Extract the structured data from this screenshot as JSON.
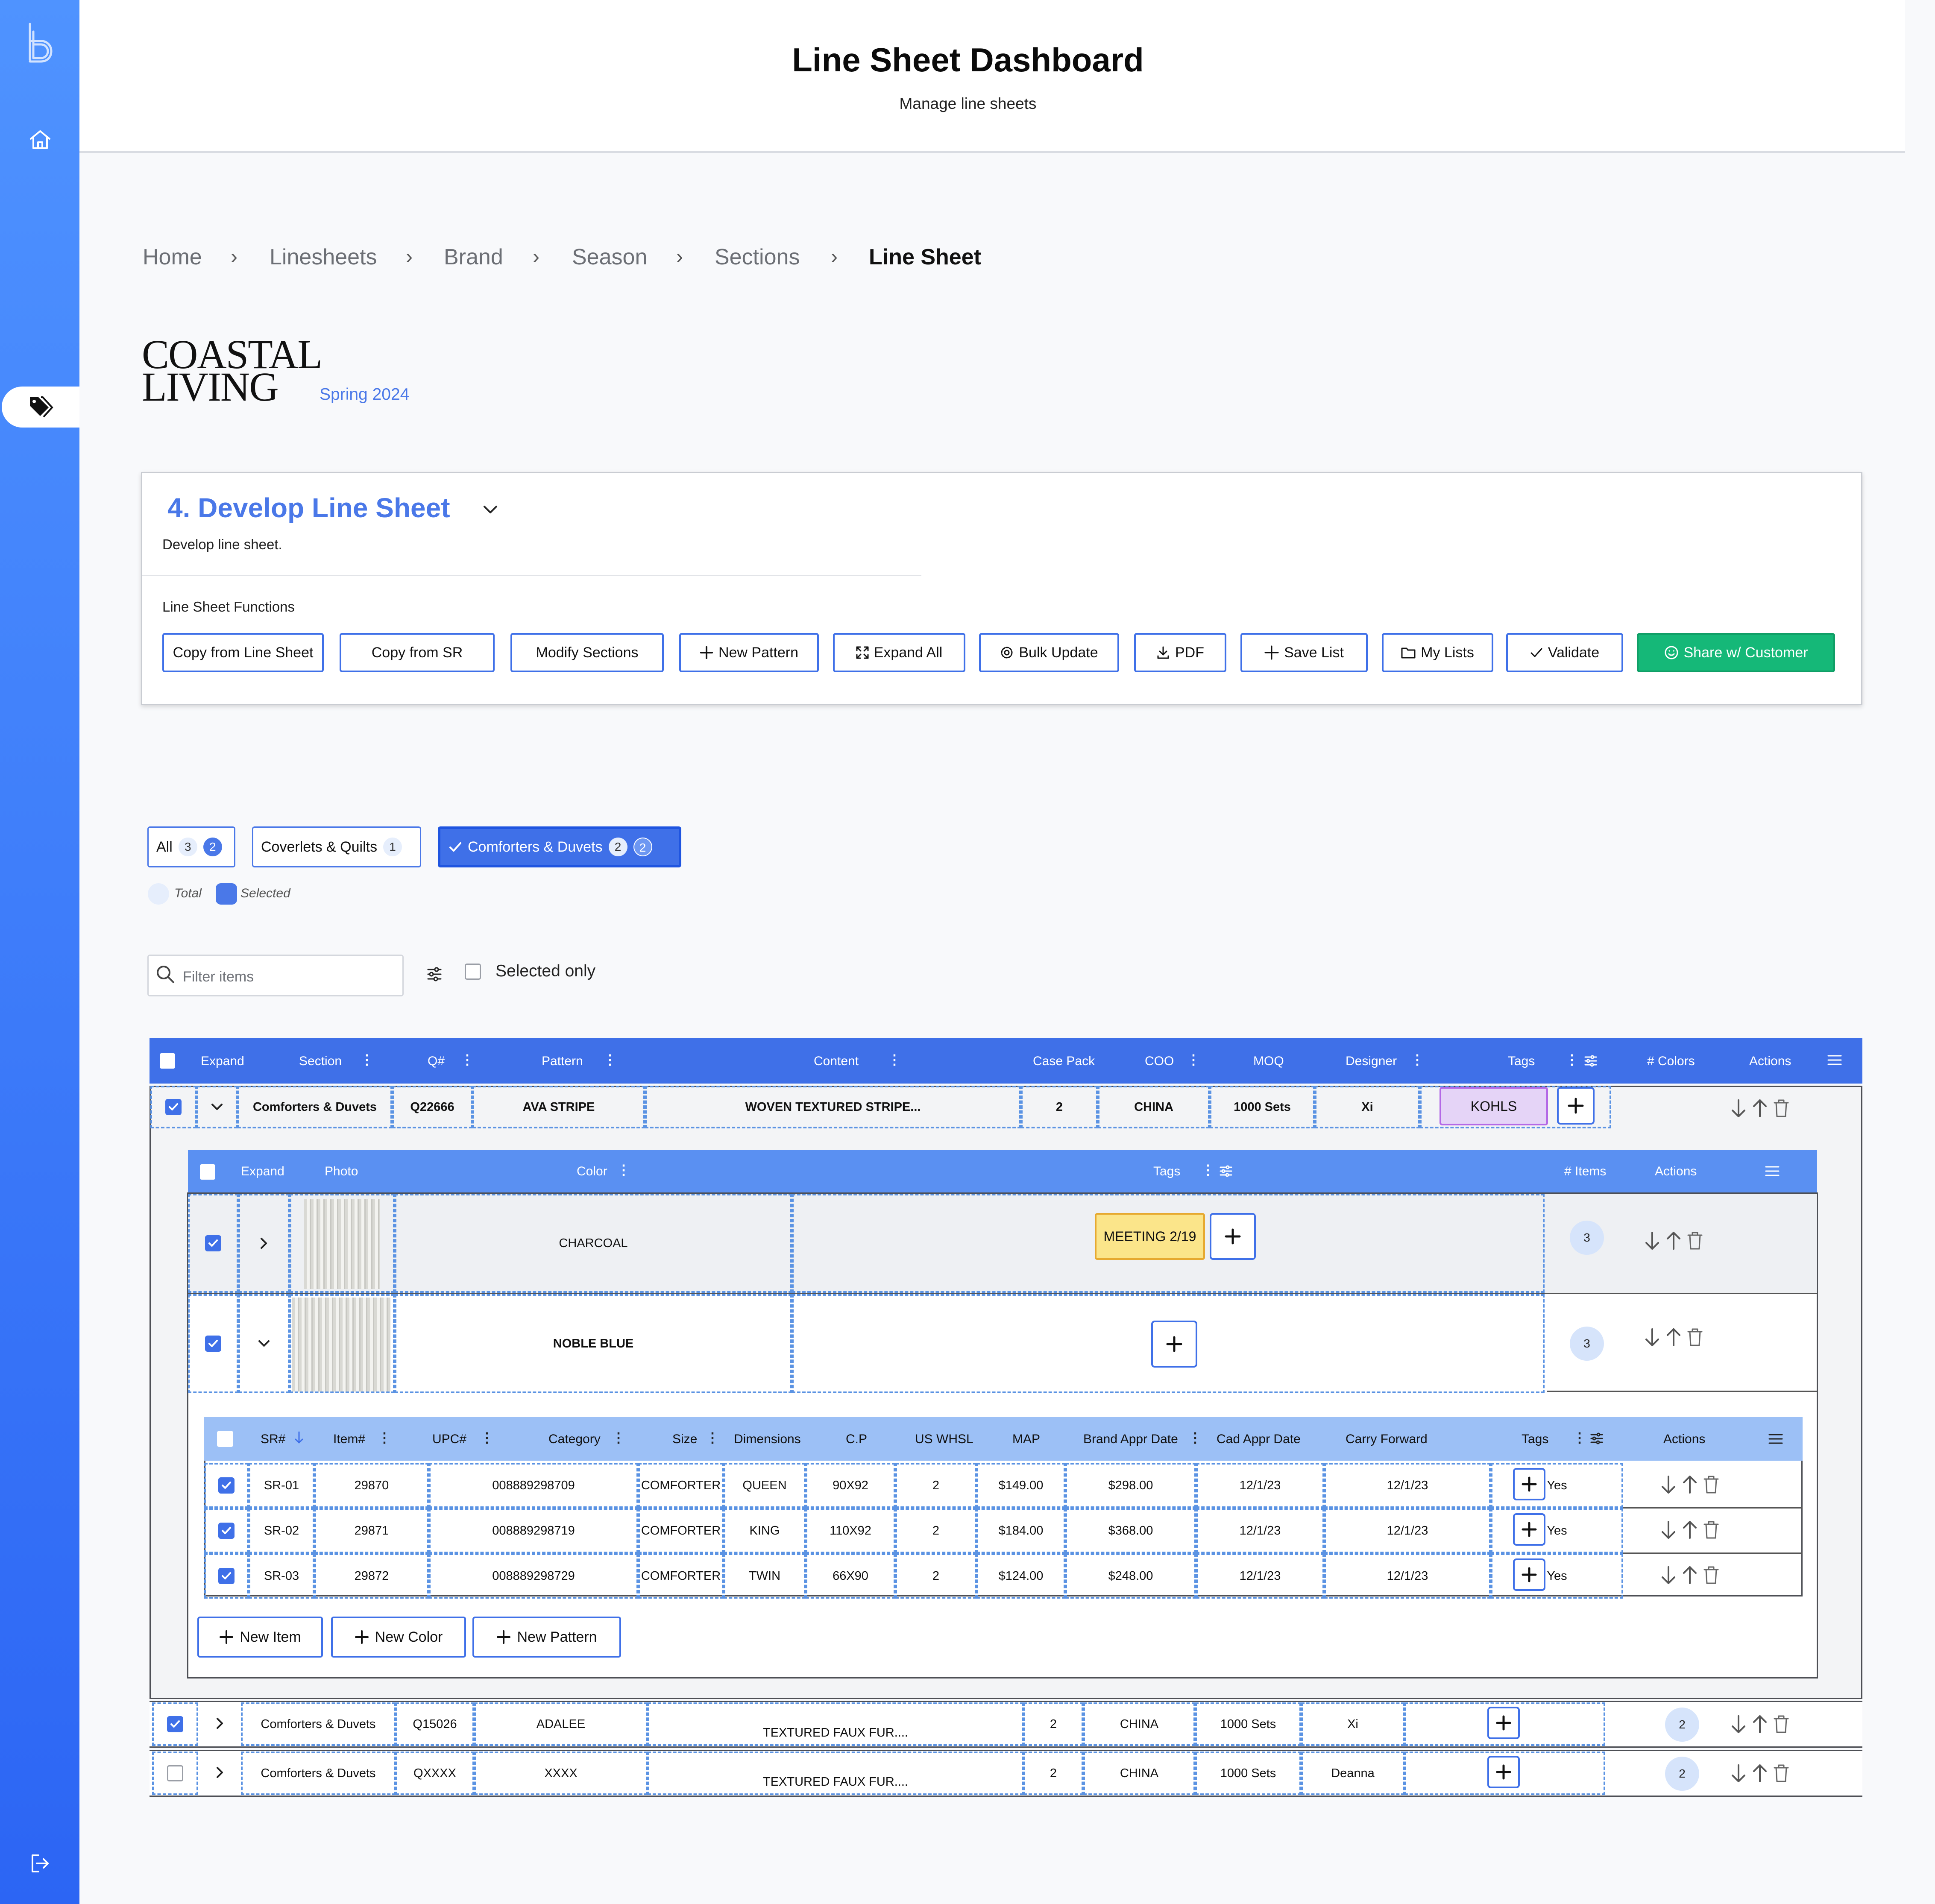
{
  "header": {
    "title": "Line Sheet Dashboard",
    "subtitle": "Manage line sheets"
  },
  "breadcrumb": [
    "Home",
    "Linesheets",
    "Brand",
    "Season",
    "Sections",
    "Line Sheet"
  ],
  "brand": {
    "logo_text": "COASTAL LIVING",
    "season": "Spring 2024"
  },
  "panel": {
    "title": "4. Develop Line Sheet",
    "description": "Develop line sheet.",
    "functions_label": "Line Sheet Functions",
    "buttons": [
      "Copy from Line Sheet",
      "Copy from SR",
      "Modify Sections",
      "New Pattern",
      "Expand All",
      "Bulk Update",
      "PDF",
      "Save List",
      "My Lists",
      "Validate",
      "Share w/ Customer"
    ]
  },
  "filters": {
    "chips": [
      {
        "label": "All",
        "total": "3",
        "selected": "2"
      },
      {
        "label": "Coverlets & Quilts",
        "total": "1"
      },
      {
        "label": "Comforters & Duvets",
        "total": "2",
        "selected": "2"
      }
    ],
    "legend_total": "Total",
    "legend_selected": "Selected"
  },
  "search": {
    "placeholder": "Filter items",
    "selected_only": "Selected only"
  },
  "table": {
    "headers": [
      "Expand",
      "Section",
      "Q#",
      "Pattern",
      "Content",
      "Case Pack",
      "COO",
      "MOQ",
      "Designer",
      "Tags",
      "# Colors",
      "Actions"
    ],
    "rows": [
      {
        "section": "Comforters & Duvets",
        "q": "Q22666",
        "pattern": "AVA STRIPE",
        "content": "WOVEN TEXTURED STRIPE...",
        "case_pack": "2",
        "coo": "CHINA",
        "moq": "1000 Sets",
        "designer": "Xi",
        "tag": "KOHLS"
      },
      {
        "section": "Comforters & Duvets",
        "q": "Q15026",
        "pattern": "ADALEE",
        "content": "TEXTURED FAUX FUR....",
        "case_pack": "2",
        "coo": "CHINA",
        "moq": "1000 Sets",
        "designer": "Xi",
        "colors": "2"
      },
      {
        "section": "Comforters & Duvets",
        "q": "QXXXX",
        "pattern": "XXXX",
        "content": "TEXTURED FAUX FUR....",
        "case_pack": "2",
        "coo": "CHINA",
        "moq": "1000 Sets",
        "designer": "Deanna",
        "colors": "2"
      }
    ]
  },
  "colors_table": {
    "headers": [
      "Expand",
      "Photo",
      "Color",
      "Tags",
      "# Items",
      "Actions"
    ],
    "rows": [
      {
        "color": "CHARCOAL",
        "tag": "MEETING 2/19",
        "items": "3"
      },
      {
        "color": "NOBLE BLUE",
        "items": "3"
      }
    ]
  },
  "items_table": {
    "headers": [
      "SR#",
      "Item#",
      "UPC#",
      "Category",
      "Size",
      "Dimensions",
      "C.P",
      "US WHSL",
      "MAP",
      "Brand Appr Date",
      "Cad Appr Date",
      "Carry Forward",
      "Tags",
      "Actions"
    ],
    "rows": [
      [
        "SR-01",
        "29870",
        "008889298709",
        "COMFORTER",
        "QUEEN",
        "90X92",
        "2",
        "$149.00",
        "$298.00",
        "12/1/23",
        "12/1/23",
        "Yes"
      ],
      [
        "SR-02",
        "29871",
        "008889298719",
        "COMFORTER",
        "KING",
        "110X92",
        "2",
        "$184.00",
        "$368.00",
        "12/1/23",
        "12/1/23",
        "Yes"
      ],
      [
        "SR-03",
        "29872",
        "008889298729",
        "COMFORTER",
        "TWIN",
        "66X90",
        "2",
        "$124.00",
        "$248.00",
        "12/1/23",
        "12/1/23",
        "Yes"
      ]
    ]
  },
  "bottom_buttons": [
    "New Item",
    "New Color",
    "New Pattern"
  ],
  "colors": {
    "primary": "#3f70e8",
    "accent_text": "#4a78e8",
    "success": "#15b878",
    "tag_purple": "#e5d4f7",
    "tag_yellow": "#fbe58a"
  }
}
